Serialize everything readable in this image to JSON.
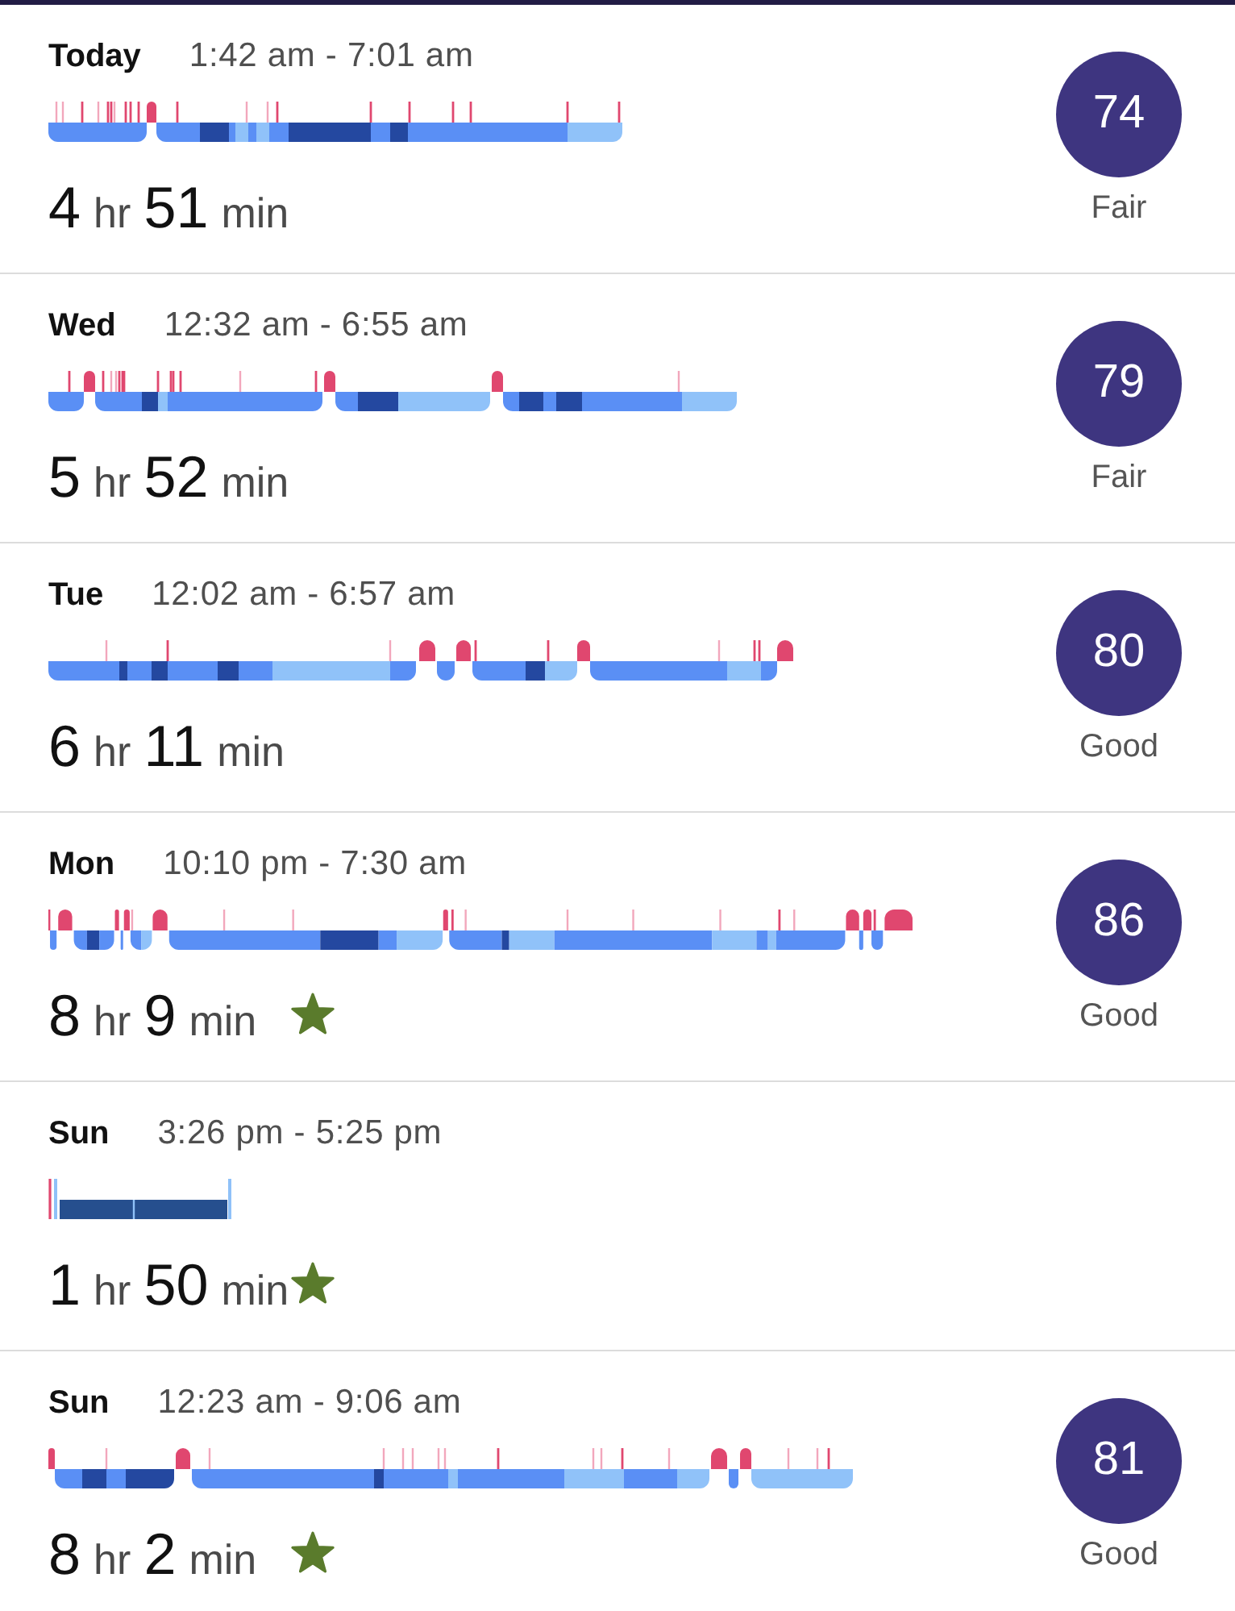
{
  "sleep_log": [
    {
      "day": "Today",
      "time_range": "1:42 am - 7:01 am",
      "duration": {
        "hours": "4",
        "hours_unit": "hr",
        "minutes": "51",
        "minutes_unit": "min"
      },
      "starred": false,
      "score": "74",
      "rating": "Fair"
    },
    {
      "day": "Wed",
      "time_range": "12:32 am - 6:55 am",
      "duration": {
        "hours": "5",
        "hours_unit": "hr",
        "minutes": "52",
        "minutes_unit": "min"
      },
      "starred": false,
      "score": "79",
      "rating": "Fair"
    },
    {
      "day": "Tue",
      "time_range": "12:02 am - 6:57 am",
      "duration": {
        "hours": "6",
        "hours_unit": "hr",
        "minutes": "11",
        "minutes_unit": "min"
      },
      "starred": false,
      "score": "80",
      "rating": "Good"
    },
    {
      "day": "Mon",
      "time_range": "10:10 pm - 7:30 am",
      "duration": {
        "hours": "8",
        "hours_unit": "hr",
        "minutes": "9",
        "minutes_unit": "min"
      },
      "starred": true,
      "score": "86",
      "rating": "Good"
    },
    {
      "day": "Sun",
      "time_range": "3:26 pm - 5:25 pm",
      "duration": {
        "hours": "1",
        "hours_unit": "hr",
        "minutes": "50",
        "minutes_unit": "min"
      },
      "starred": true
    },
    {
      "day": "Sun",
      "time_range": "12:23 am - 9:06 am",
      "duration": {
        "hours": "8",
        "hours_unit": "hr",
        "minutes": "2",
        "minutes_unit": "min"
      },
      "starred": true,
      "score": "81",
      "rating": "Good"
    }
  ]
}
